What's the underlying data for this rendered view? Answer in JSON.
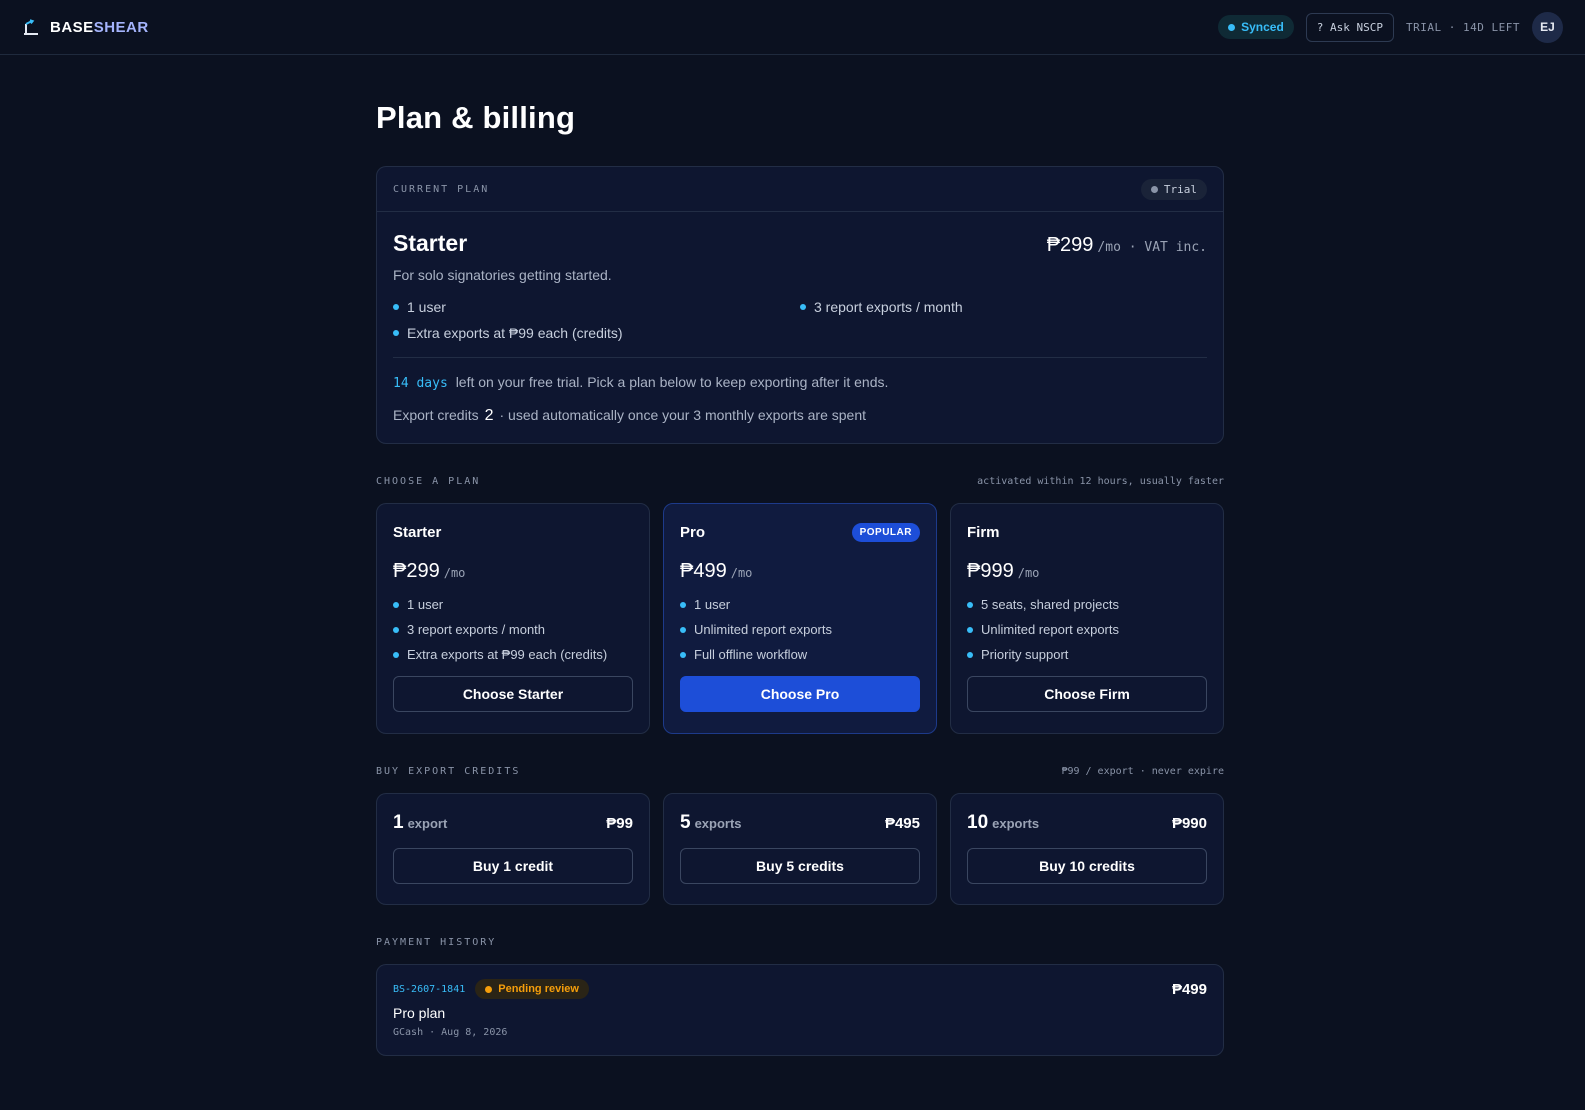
{
  "app": {
    "brand_part1": "BASE",
    "brand_part2": "SHEAR",
    "brand_icon": "ruler-arrow-icon"
  },
  "topbar": {
    "sync_status": "Synced",
    "ask_label": "? Ask NSCP",
    "trial_label": "TRIAL · 14D LEFT",
    "avatar_initials": "EJ"
  },
  "page": {
    "title": "Plan & billing"
  },
  "current_plan": {
    "section_label": "CURRENT PLAN",
    "status_badge": "Trial",
    "name": "Starter",
    "price": "₱299",
    "price_suffix": "/mo · VAT inc.",
    "description": "For solo signatories getting started.",
    "features": [
      "1 user",
      "3 report exports / month",
      "Extra exports at ₱99 each (credits)"
    ],
    "trial_days": "14 days",
    "trial_text": "left on your free trial. Pick a plan below to keep exporting after it ends.",
    "credits_label": "Export credits",
    "credits_value": "2",
    "credits_text": "· used automatically once your 3 monthly exports are spent"
  },
  "choose_plan": {
    "section_label": "CHOOSE A PLAN",
    "note": "activated within 12 hours, usually faster",
    "plans": [
      {
        "name": "Starter",
        "price": "₱299",
        "suffix": "/mo",
        "features": [
          "1 user",
          "3 report exports / month",
          "Extra exports at ₱99 each (credits)"
        ],
        "button": "Choose Starter"
      },
      {
        "name": "Pro",
        "badge": "POPULAR",
        "price": "₱499",
        "suffix": "/mo",
        "features": [
          "1 user",
          "Unlimited report exports",
          "Full offline workflow"
        ],
        "button": "Choose Pro"
      },
      {
        "name": "Firm",
        "price": "₱999",
        "suffix": "/mo",
        "features": [
          "5 seats, shared projects",
          "Unlimited report exports",
          "Priority support"
        ],
        "button": "Choose Firm"
      }
    ]
  },
  "buy_credits": {
    "section_label": "BUY EXPORT CREDITS",
    "note": "₱99 / export · never expire",
    "packs": [
      {
        "qty": "1",
        "unit": "export",
        "price": "₱99",
        "button": "Buy 1 credit"
      },
      {
        "qty": "5",
        "unit": "exports",
        "price": "₱495",
        "button": "Buy 5 credits"
      },
      {
        "qty": "10",
        "unit": "exports",
        "price": "₱990",
        "button": "Buy 10 credits"
      }
    ]
  },
  "payment_history": {
    "section_label": "PAYMENT HISTORY",
    "items": [
      {
        "id": "BS-2607-1841",
        "status": "Pending review",
        "amount": "₱499",
        "title": "Pro plan",
        "meta": "GCash · Aug 8, 2026"
      }
    ]
  },
  "colors": {
    "background": "#0b1120",
    "card": "#0e1630",
    "accent": "#38bdf8",
    "primary": "#1d4ed8",
    "pending": "#f59e0b"
  }
}
